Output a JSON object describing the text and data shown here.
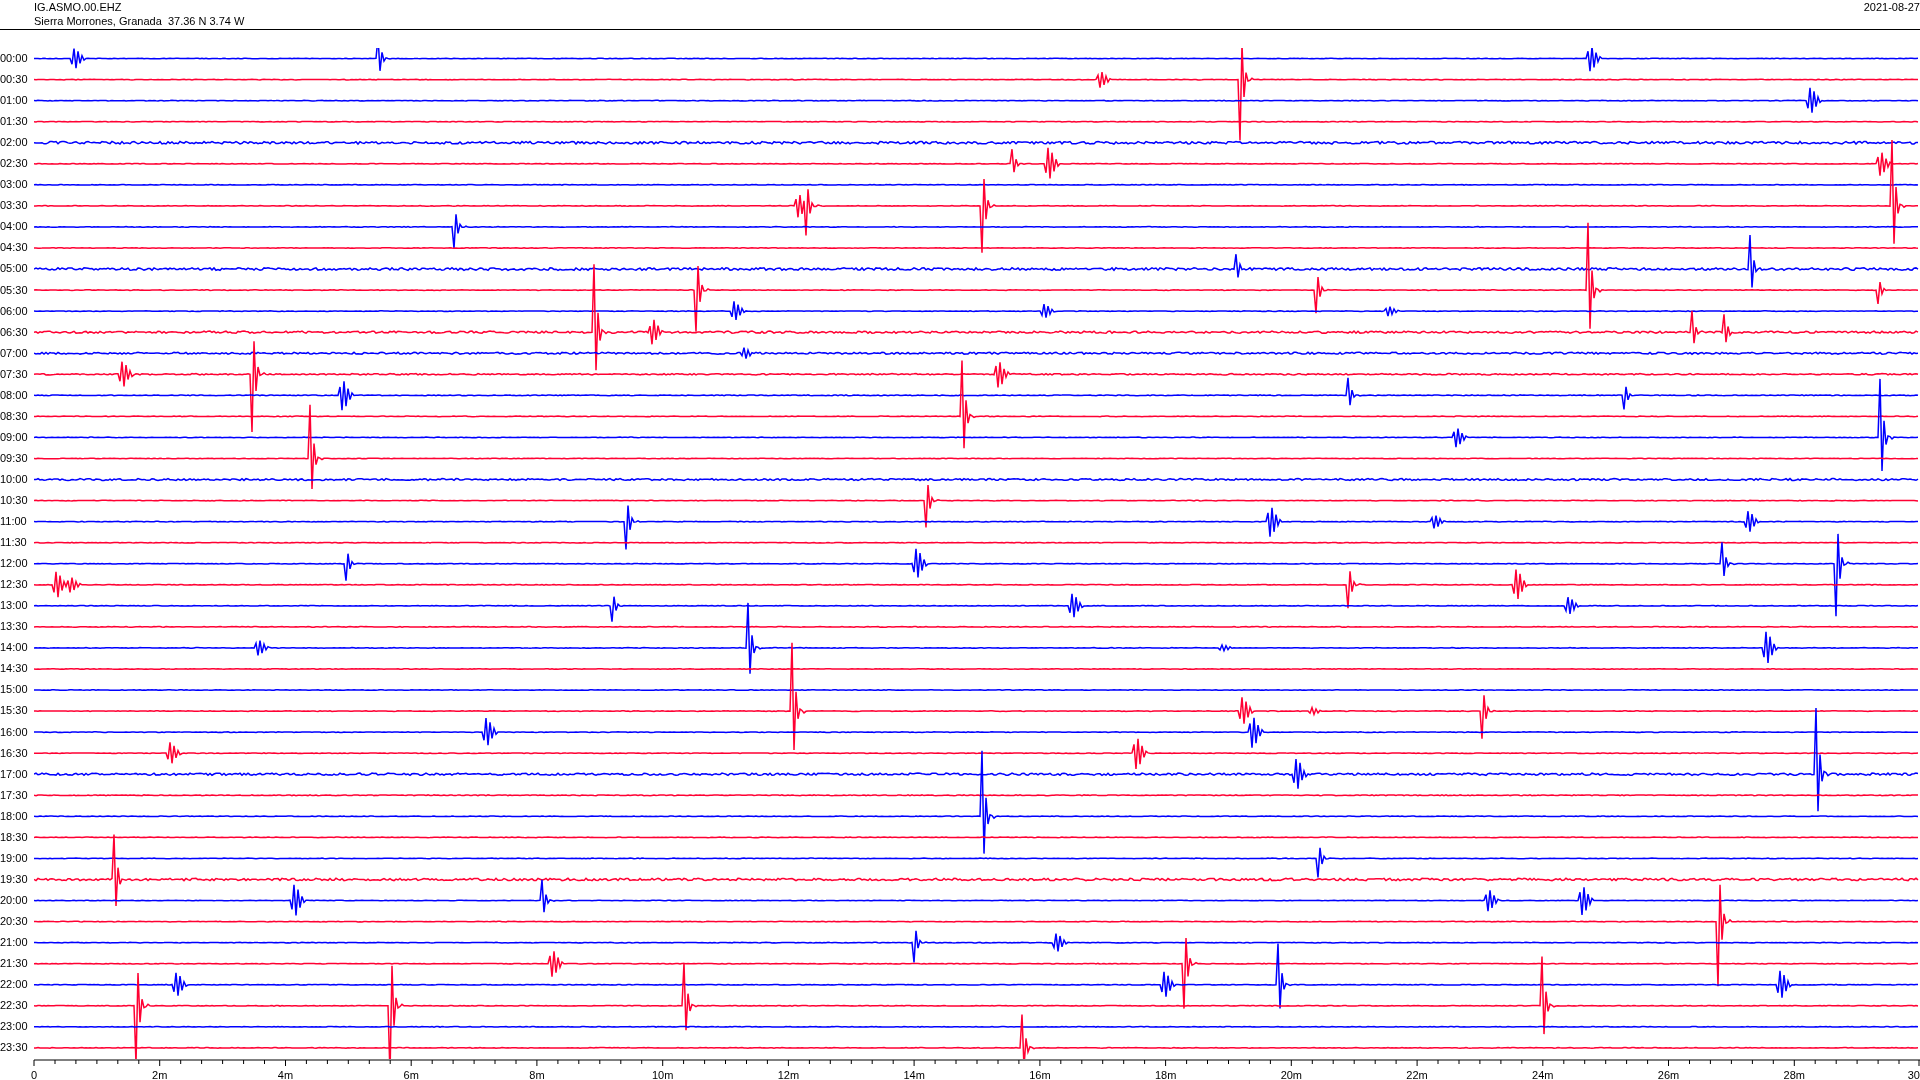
{
  "header": {
    "station": "IG.ASMO.00.EHZ",
    "location": "Sierra Morrones, Granada  37.36 N 3.74 W",
    "date": "2021-08-27"
  },
  "rows": [
    {
      "time": "00:00",
      "color": "#0000ff"
    },
    {
      "time": "00:30",
      "color": "#ff0033"
    },
    {
      "time": "01:00",
      "color": "#0000ff"
    },
    {
      "time": "01:30",
      "color": "#ff0033"
    },
    {
      "time": "02:00",
      "color": "#0000ff"
    },
    {
      "time": "02:30",
      "color": "#ff0033"
    },
    {
      "time": "03:00",
      "color": "#0000ff"
    },
    {
      "time": "03:30",
      "color": "#ff0033"
    },
    {
      "time": "04:00",
      "color": "#0000ff"
    },
    {
      "time": "04:30",
      "color": "#ff0033"
    },
    {
      "time": "05:00",
      "color": "#0000ff"
    },
    {
      "time": "05:30",
      "color": "#ff0033"
    },
    {
      "time": "06:00",
      "color": "#0000ff"
    },
    {
      "time": "06:30",
      "color": "#ff0033"
    },
    {
      "time": "07:00",
      "color": "#0000ff"
    },
    {
      "time": "07:30",
      "color": "#ff0033"
    },
    {
      "time": "08:00",
      "color": "#0000ff"
    },
    {
      "time": "08:30",
      "color": "#ff0033"
    },
    {
      "time": "09:00",
      "color": "#0000ff"
    },
    {
      "time": "09:30",
      "color": "#ff0033"
    },
    {
      "time": "10:00",
      "color": "#0000ff"
    },
    {
      "time": "10:30",
      "color": "#ff0033"
    },
    {
      "time": "11:00",
      "color": "#0000ff"
    },
    {
      "time": "11:30",
      "color": "#ff0033"
    },
    {
      "time": "12:00",
      "color": "#0000ff"
    },
    {
      "time": "12:30",
      "color": "#ff0033"
    },
    {
      "time": "13:00",
      "color": "#0000ff"
    },
    {
      "time": "13:30",
      "color": "#ff0033"
    },
    {
      "time": "14:00",
      "color": "#0000ff"
    },
    {
      "time": "14:30",
      "color": "#ff0033"
    },
    {
      "time": "15:00",
      "color": "#0000ff"
    },
    {
      "time": "15:30",
      "color": "#ff0033"
    },
    {
      "time": "16:00",
      "color": "#0000ff"
    },
    {
      "time": "16:30",
      "color": "#ff0033"
    },
    {
      "time": "17:00",
      "color": "#0000ff"
    },
    {
      "time": "17:30",
      "color": "#ff0033"
    },
    {
      "time": "18:00",
      "color": "#0000ff"
    },
    {
      "time": "18:30",
      "color": "#ff0033"
    },
    {
      "time": "19:00",
      "color": "#0000ff"
    },
    {
      "time": "19:30",
      "color": "#ff0033"
    },
    {
      "time": "20:00",
      "color": "#0000ff"
    },
    {
      "time": "20:30",
      "color": "#ff0033"
    },
    {
      "time": "21:00",
      "color": "#0000ff"
    },
    {
      "time": "21:30",
      "color": "#ff0033"
    },
    {
      "time": "22:00",
      "color": "#0000ff"
    },
    {
      "time": "22:30",
      "color": "#ff0033"
    },
    {
      "time": "23:00",
      "color": "#0000ff"
    },
    {
      "time": "23:30",
      "color": "#ff0033"
    }
  ],
  "x_axis": {
    "ticks": [
      "0",
      "2m",
      "4m",
      "6m",
      "8m",
      "10m",
      "12m",
      "14m",
      "16m",
      "18m",
      "20m",
      "22m",
      "24m",
      "26m",
      "28m",
      "30"
    ]
  }
}
